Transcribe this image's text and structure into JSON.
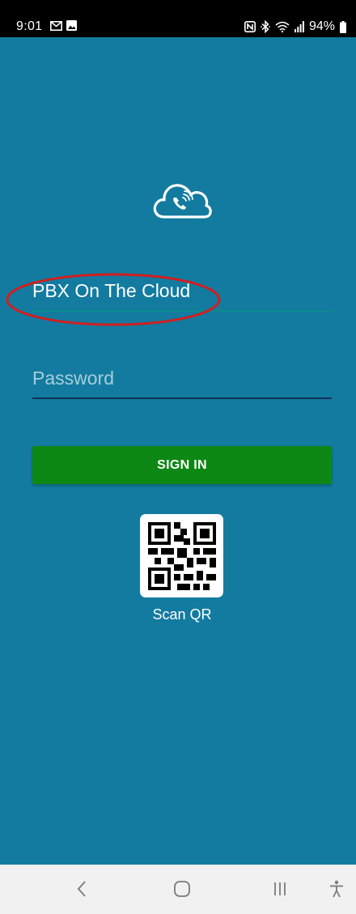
{
  "status_bar": {
    "time": "9:01",
    "battery": "94%",
    "left_icons": [
      "gmail-icon",
      "image-icon"
    ],
    "right_icons": [
      "nfc-icon",
      "bluetooth-icon",
      "wifi-icon",
      "signal-icon",
      "battery-icon"
    ]
  },
  "login": {
    "server_value": "PBX On The Cloud",
    "password_placeholder": "Password",
    "sign_in_label": "SIGN IN",
    "scan_qr_label": "Scan QR"
  },
  "nav": {
    "buttons": [
      "back-icon",
      "home-icon",
      "recents-icon",
      "accessibility-icon"
    ]
  },
  "colors": {
    "app_background": "#137ba0",
    "sign_in_button": "#0d8814",
    "annotation": "#d01f1f"
  }
}
